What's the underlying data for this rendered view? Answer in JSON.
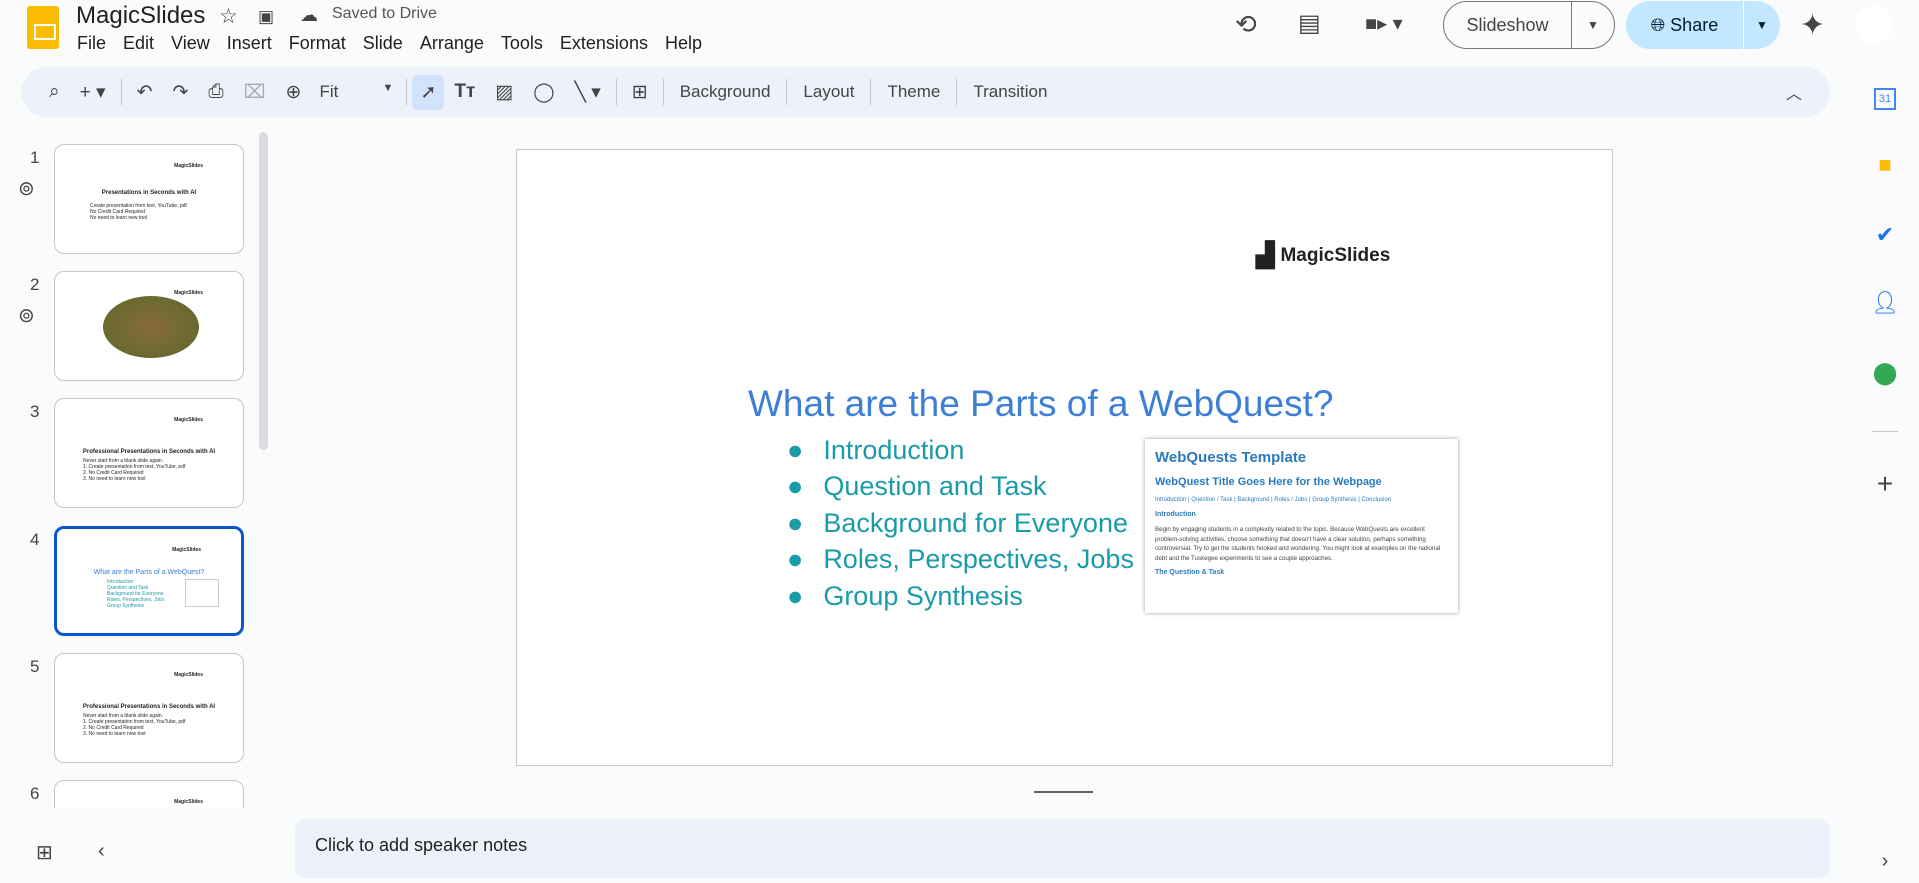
{
  "app": {
    "title": "MagicSlides",
    "save_status": "Saved to Drive"
  },
  "menu": [
    "File",
    "Edit",
    "View",
    "Insert",
    "Format",
    "Slide",
    "Arrange",
    "Tools",
    "Extensions",
    "Help"
  ],
  "header": {
    "slideshow_label": "Slideshow",
    "share_label": "Share"
  },
  "toolbar": {
    "zoom_value": "Fit",
    "background": "Background",
    "layout": "Layout",
    "theme": "Theme",
    "transition": "Transition"
  },
  "slides": [
    {
      "num": "1",
      "logo": "MagicSlides",
      "title": "Presentations in Seconds with AI",
      "bullets": [
        "Create presentation from text, YouTube, pdf",
        "No Credit Card Required",
        "No need to learn new tool"
      ]
    },
    {
      "num": "2",
      "logo": "MagicSlides"
    },
    {
      "num": "3",
      "logo": "MagicSlides",
      "title": "Professional Presentations in Seconds with AI",
      "bullets": [
        "Never start from a blank slide again.",
        "1. Create presentation from text, YouTube, pdf",
        "2. No Credit Card Required",
        "3. No need to learn new tool"
      ]
    },
    {
      "num": "4",
      "logo": "MagicSlides",
      "title": "What are the Parts of a WebQuest?",
      "bullets": [
        "Introduction",
        "Question and Task",
        "Background for Everyone",
        "Roles, Perspectives, Jobs",
        "Group Synthesis"
      ]
    },
    {
      "num": "5",
      "logo": "MagicSlides",
      "title": "Professional Presentations in Seconds with AI",
      "bullets": [
        "Never start from a blank slide again.",
        "1. Create presentation from text, YouTube, pdf",
        "2. No Credit Card Required",
        "3. No need to learn new tool"
      ]
    },
    {
      "num": "6",
      "logo": "MagicSlides"
    }
  ],
  "current_slide": {
    "logo": "MagicSlides",
    "title": "What are the Parts of a WebQuest?",
    "bullets": [
      "Introduction",
      "Question and Task",
      "Background for Everyone",
      "Roles, Perspectives, Jobs",
      "Group Synthesis"
    ],
    "image": {
      "heading": "WebQuests Template",
      "subheading": "WebQuest Title Goes Here for the Webpage",
      "nav": "Introduction | Question / Task | Background | Roles / Jobs | Group Synthesis |  Conclusion",
      "section": "Introduction",
      "body": "Begin by engaging students in a complexity related to the topic. Because WebQuests are excellent problem-solving activities, choose something that doesn't have a clear solution, perhaps something controversial. Try to get the students hooked and wondering. You might look at examples on the national debt and the Tuskegee experiments to see a couple approaches.",
      "section2": "The Question & Task"
    }
  },
  "notes": {
    "placeholder": "Click to add speaker notes"
  },
  "colors": {
    "accent": "#0b57d0",
    "title": "#3d7fd6",
    "bullet": "#1a9ba8"
  }
}
